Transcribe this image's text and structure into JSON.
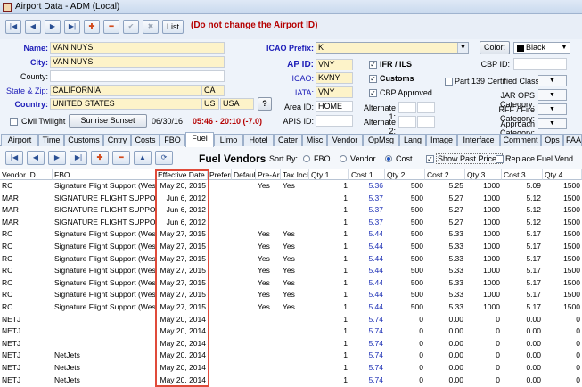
{
  "window": {
    "title": "Airport Data - ADM (Local)"
  },
  "toolbar": {
    "first": "|◀",
    "prev": "◀",
    "next": "▶",
    "last": "▶|",
    "add": "✚",
    "delete": "━",
    "save": "✔",
    "cancel": "✖",
    "list_label": "List",
    "warning": "(Do not change the Airport ID)"
  },
  "form": {
    "name_label": "Name:",
    "name": "VAN NUYS",
    "city_label": "City:",
    "city": "VAN NUYS",
    "county_label": "County:",
    "county": "",
    "state_label": "State & Zip:",
    "state": "CALIFORNIA",
    "state_code": "CA",
    "country_label": "Country:",
    "country": "UNITED STATES",
    "country_code": "US",
    "country_name": "USA",
    "help": "?",
    "icao_prefix_label": "ICAO Prefix:",
    "icao_prefix": "K",
    "ap_id_label": "AP ID:",
    "ap_id": "VNY",
    "icao_label": "ICAO:",
    "icao": "KVNY",
    "iata_label": "IATA:",
    "iata": "VNY",
    "area_id_label": "Area ID:",
    "area_id": "HOME",
    "apis_id_label": "APIS ID:",
    "apis_id": "",
    "alt1_label": "Alternate 1:",
    "alt2_label": "Alternate 2:",
    "ifr_label": "IFR / ILS",
    "customs_label": "Customs",
    "cbp_label": "CBP Approved",
    "color_btn": "Color:",
    "color_value": "Black",
    "cbp_id_label": "CBP ID:",
    "part139_label": "Part 139 Certified Class:",
    "jar_label": "JAR OPS Category:",
    "rff_label": "RFF / Fire Category:",
    "approach_label": "Approach Category:",
    "civil_twilight": "Civil Twilight",
    "sunrise_btn": "Sunrise Sunset",
    "date": "06/30/16",
    "sun_times": "05:46 - 20:10 (-7.0)"
  },
  "tabs": [
    "Airport",
    "Time",
    "Customs",
    "Cntry",
    "Costs",
    "FBO",
    "Fuel",
    "Limo",
    "Hotel",
    "Cater",
    "Misc",
    "Vendor",
    "OpMsg",
    "Lang",
    "Image",
    "Interface",
    "Comment",
    "Ops",
    "FAA Wx"
  ],
  "active_tab": "Fuel",
  "fuel": {
    "header": "Fuel Vendors",
    "sort_label": "Sort By:",
    "sort_fbo": "FBO",
    "sort_vendor": "Vendor",
    "sort_cost": "Cost",
    "show_past": "Show Past Prices",
    "replace": "Replace Fuel Vend",
    "columns": [
      "Vendor ID",
      "FBO",
      "Effective Date",
      "Preferred",
      "Default",
      "Pre-Arr",
      "Tax Incl",
      "Qty 1",
      "Cost 1",
      "Qty 2",
      "Cost 2",
      "Qty 3",
      "Cost 3",
      "Qty 4"
    ],
    "rows": [
      [
        "RC",
        "Signature Flight Support (West)",
        "May 20, 2015",
        "",
        "",
        "Yes",
        "Yes",
        "1",
        "5.36",
        "500",
        "5.25",
        "1000",
        "5.09",
        "1500"
      ],
      [
        "MAR",
        "SIGNATURE FLIGHT SUPPORT",
        "Jun 6, 2012",
        "",
        "",
        "",
        "",
        "1",
        "5.37",
        "500",
        "5.27",
        "1000",
        "5.12",
        "1500"
      ],
      [
        "MAR",
        "SIGNATURE FLIGHT SUPPORT",
        "Jun 6, 2012",
        "",
        "",
        "",
        "",
        "1",
        "5.37",
        "500",
        "5.27",
        "1000",
        "5.12",
        "1500"
      ],
      [
        "MAR",
        "SIGNATURE FLIGHT SUPPORT",
        "Jun 6, 2012",
        "",
        "",
        "",
        "",
        "1",
        "5.37",
        "500",
        "5.27",
        "1000",
        "5.12",
        "1500"
      ],
      [
        "RC",
        "Signature Flight Support (West)",
        "May 27, 2015",
        "",
        "",
        "Yes",
        "Yes",
        "1",
        "5.44",
        "500",
        "5.33",
        "1000",
        "5.17",
        "1500"
      ],
      [
        "RC",
        "Signature Flight Support (West)",
        "May 27, 2015",
        "",
        "",
        "Yes",
        "Yes",
        "1",
        "5.44",
        "500",
        "5.33",
        "1000",
        "5.17",
        "1500"
      ],
      [
        "RC",
        "Signature Flight Support (West)",
        "May 27, 2015",
        "",
        "",
        "Yes",
        "Yes",
        "1",
        "5.44",
        "500",
        "5.33",
        "1000",
        "5.17",
        "1500"
      ],
      [
        "RC",
        "Signature Flight Support (West)",
        "May 27, 2015",
        "",
        "",
        "Yes",
        "Yes",
        "1",
        "5.44",
        "500",
        "5.33",
        "1000",
        "5.17",
        "1500"
      ],
      [
        "RC",
        "Signature Flight Support (West)",
        "May 27, 2015",
        "",
        "",
        "Yes",
        "Yes",
        "1",
        "5.44",
        "500",
        "5.33",
        "1000",
        "5.17",
        "1500"
      ],
      [
        "RC",
        "Signature Flight Support (West)",
        "May 27, 2015",
        "",
        "",
        "Yes",
        "Yes",
        "1",
        "5.44",
        "500",
        "5.33",
        "1000",
        "5.17",
        "1500"
      ],
      [
        "RC",
        "Signature Flight Support (West)",
        "May 27, 2015",
        "",
        "",
        "Yes",
        "Yes",
        "1",
        "5.44",
        "500",
        "5.33",
        "1000",
        "5.17",
        "1500"
      ],
      [
        "NETJ",
        "",
        "May 20, 2014",
        "",
        "",
        "",
        "",
        "1",
        "5.74",
        "0",
        "0.00",
        "0",
        "0.00",
        "0"
      ],
      [
        "NETJ",
        "",
        "May 20, 2014",
        "",
        "",
        "",
        "",
        "1",
        "5.74",
        "0",
        "0.00",
        "0",
        "0.00",
        "0"
      ],
      [
        "NETJ",
        "",
        "May 20, 2014",
        "",
        "",
        "",
        "",
        "1",
        "5.74",
        "0",
        "0.00",
        "0",
        "0.00",
        "0"
      ],
      [
        "NETJ",
        "NetJets",
        "May 20, 2014",
        "",
        "",
        "",
        "",
        "1",
        "5.74",
        "0",
        "0.00",
        "0",
        "0.00",
        "0"
      ],
      [
        "NETJ",
        "NetJets",
        "May 20, 2014",
        "",
        "",
        "",
        "",
        "1",
        "5.74",
        "0",
        "0.00",
        "0",
        "0.00",
        "0"
      ],
      [
        "NETJ",
        "NetJets",
        "May 20, 2014",
        "",
        "",
        "",
        "",
        "1",
        "5.74",
        "0",
        "0.00",
        "0",
        "0.00",
        "0"
      ]
    ]
  }
}
